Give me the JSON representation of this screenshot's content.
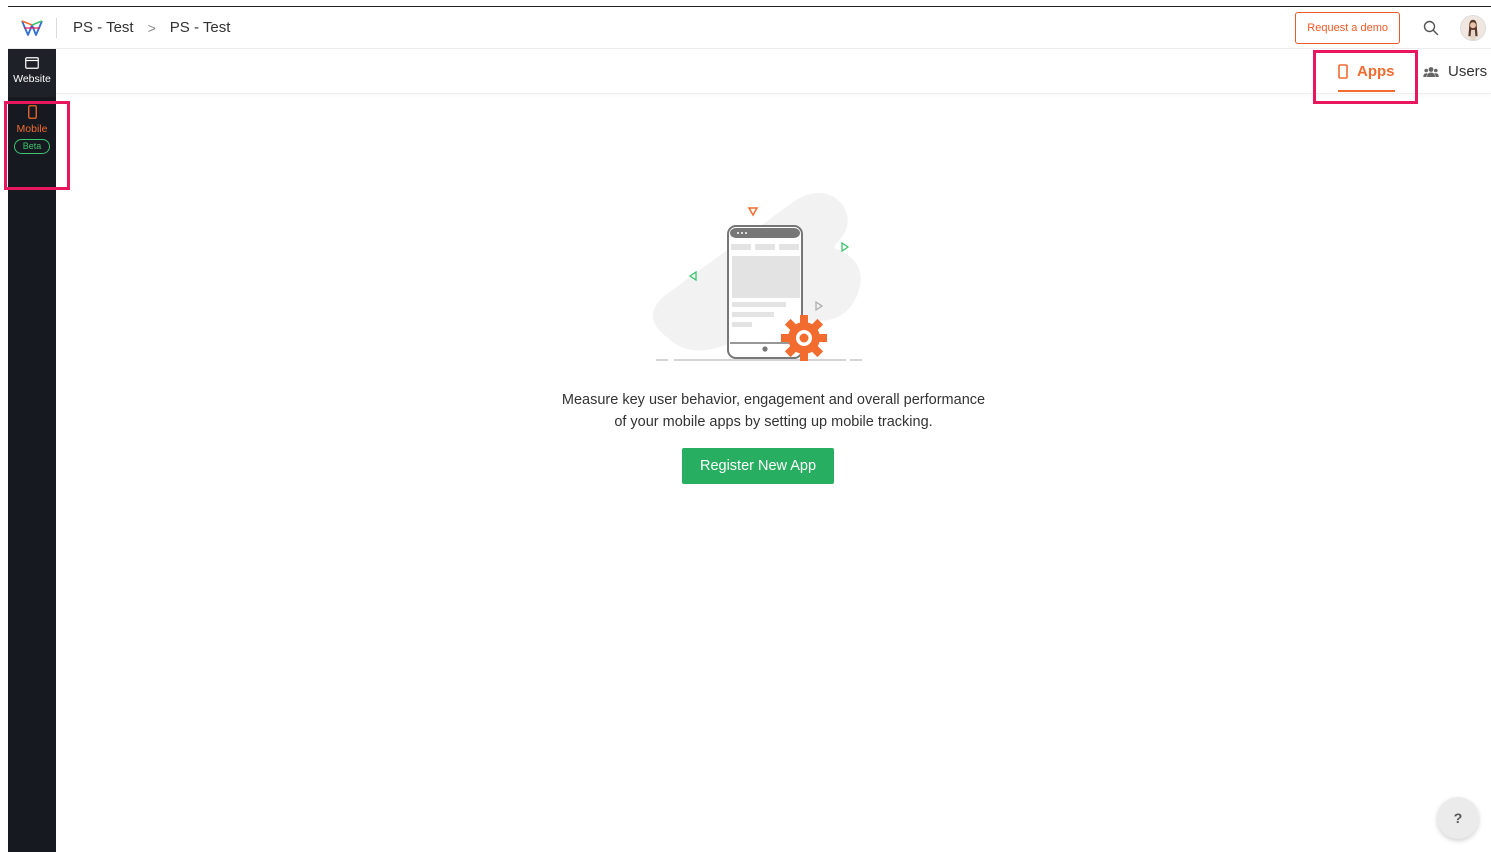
{
  "breadcrumb": {
    "items": [
      "PS - Test",
      "PS - Test"
    ],
    "separator": ">"
  },
  "header": {
    "request_demo_label": "Request a demo",
    "search_icon": "search-icon",
    "avatar_icon": "user-avatar"
  },
  "sidebar": {
    "items": [
      {
        "label": "Website",
        "icon": "browser-window-icon",
        "active": false
      },
      {
        "label": "Mobile",
        "icon": "mobile-phone-icon",
        "active": true,
        "badge": "Beta"
      }
    ]
  },
  "subnav": {
    "tabs": [
      {
        "label": "Apps",
        "icon": "mobile-phone-icon",
        "active": true
      },
      {
        "label": "Users",
        "icon": "users-group-icon",
        "active": false
      }
    ]
  },
  "empty_state": {
    "message_line1": "Measure key user behavior, engagement and overall performance",
    "message_line2": "of your mobile apps by setting up mobile tracking.",
    "cta_label": "Register New App"
  },
  "help": {
    "label": "?"
  },
  "colors": {
    "accent": "#f26b2f",
    "cta": "#27ae60",
    "sidebar_bg": "#16191f",
    "highlight": "#e8175d",
    "beta": "#3ec46d"
  }
}
